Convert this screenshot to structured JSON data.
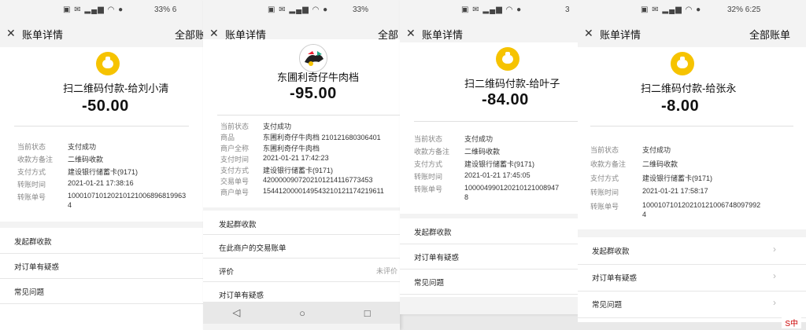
{
  "panels": [
    {
      "status_right": "33% 6",
      "nav": {
        "title": "账单详情",
        "right": "全部账"
      },
      "payee": "扫二维码付款-给刘小清",
      "amount": "-50.00",
      "rows": [
        {
          "k": "当前状态",
          "v": "支付成功"
        },
        {
          "k": "收款方备注",
          "v": "二维码收款"
        },
        {
          "k": "支付方式",
          "v": "建设银行储蓄卡(9171)"
        },
        {
          "k": "转账时间",
          "v": "2021-01-21 17:38:16"
        },
        {
          "k": "转账单号",
          "v": "100010710120210121006896819963",
          "v2": "4"
        }
      ],
      "menu": [
        {
          "label": "发起群收款"
        },
        {
          "label": "对订单有疑惑"
        },
        {
          "label": "常见问题"
        }
      ]
    },
    {
      "status_right": "33%",
      "nav": {
        "title": "账单详情",
        "right": "全部"
      },
      "payee": "东圃利奇仔牛肉档",
      "amount": "-95.00",
      "rows": [
        {
          "k": "当前状态",
          "v": "支付成功"
        },
        {
          "k": "商品",
          "v": "东圃利奇仔牛肉档 210121680306401"
        },
        {
          "k": "商户全称",
          "v": "东圃利奇仔牛肉档"
        },
        {
          "k": "支付时间",
          "v": "2021-01-21 17:42:23"
        },
        {
          "k": "支付方式",
          "v": "建设银行储蓄卡(9171)"
        },
        {
          "k": "交易单号",
          "v": "4200000907202101214116773453"
        },
        {
          "k": "商户单号",
          "v": "1544120000149543210121174219611"
        }
      ],
      "menu": [
        {
          "label": "发起群收款"
        },
        {
          "label": "在此商户的交易账单"
        },
        {
          "label": "评价",
          "sub": "未评价"
        },
        {
          "label": "对订单有疑惑"
        }
      ]
    },
    {
      "status_right": "3",
      "nav": {
        "title": "账单详情",
        "right": ""
      },
      "payee": "扫二维码付款-给叶子",
      "amount": "-84.00",
      "rows": [
        {
          "k": "当前状态",
          "v": "支付成功"
        },
        {
          "k": "收款方备注",
          "v": "二维码收款"
        },
        {
          "k": "支付方式",
          "v": "建设银行储蓄卡(9171)"
        },
        {
          "k": "转账时间",
          "v": "2021-01-21 17:45:05"
        },
        {
          "k": "转账单号",
          "v": "100004990120210121008947",
          "v2": "8"
        }
      ],
      "menu": [
        {
          "label": "发起群收款"
        },
        {
          "label": "对订单有疑惑"
        },
        {
          "label": "常见问题"
        }
      ]
    },
    {
      "status_right": "32% 6:25",
      "nav": {
        "title": "账单详情",
        "right": "全部账单"
      },
      "payee": "扫二维码付款-给张永",
      "amount": "-8.00",
      "rows": [
        {
          "k": "当前状态",
          "v": "支付成功"
        },
        {
          "k": "收款方备注",
          "v": "二维码收款"
        },
        {
          "k": "支付方式",
          "v": "建设银行储蓄卡(9171)"
        },
        {
          "k": "转账时间",
          "v": "2021-01-21 17:58:17"
        },
        {
          "k": "转账单号",
          "v": "100010710120210121006748097992",
          "v2": "4"
        }
      ],
      "menu": [
        {
          "label": "发起群收款"
        },
        {
          "label": "对订单有疑惑"
        },
        {
          "label": "常见问题"
        }
      ]
    }
  ],
  "ime": "S中",
  "icons": {
    "close": "close-icon",
    "chevron": "chevron-right-icon",
    "coin": "money-bag-icon",
    "back": "back-triangle-icon",
    "home": "home-circle-icon",
    "recent": "recent-square-icon"
  }
}
